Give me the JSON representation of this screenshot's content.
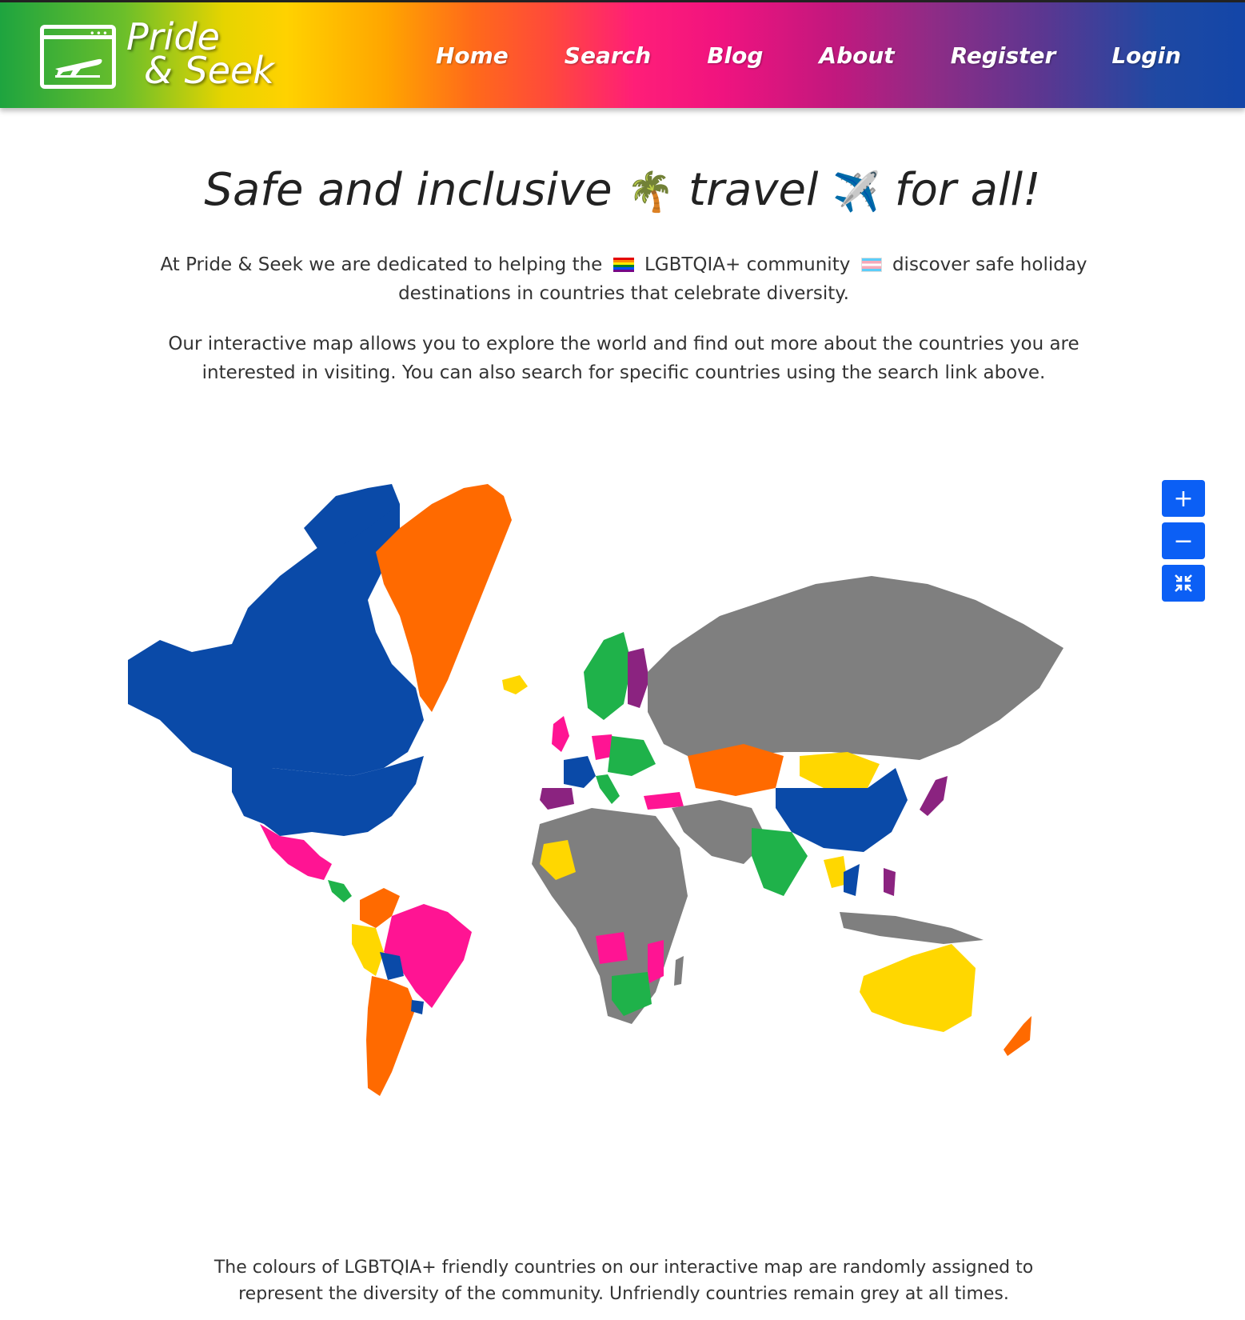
{
  "brand": {
    "line1": "Pride",
    "line2": "& Seek"
  },
  "nav": [
    {
      "label": "Home"
    },
    {
      "label": "Search"
    },
    {
      "label": "Blog"
    },
    {
      "label": "About"
    },
    {
      "label": "Register"
    },
    {
      "label": "Login"
    }
  ],
  "hero": {
    "headline_part1": "Safe and inclusive",
    "headline_emoji1": "🌴",
    "headline_part2": "travel",
    "headline_emoji2": "✈️",
    "headline_part3": "for all!",
    "intro_a": "At Pride & Seek we are dedicated to helping the",
    "intro_b": "LGBTQIA+ community",
    "intro_c": "discover safe holiday destinations in countries that celebrate diversity.",
    "map_intro": "Our interactive map allows you to explore the world and find out more about the countries you are interested in visiting. You can also search for specific countries using the search link above."
  },
  "map_controls": {
    "zoom_in": "+",
    "zoom_out": "−",
    "reset": "⤧"
  },
  "colors": {
    "blue": "#0a4aa8",
    "orange": "#ff6a00",
    "pink": "#ff1493",
    "purple": "#8b2380",
    "green": "#1fb24a",
    "yellow": "#ffd700",
    "grey": "#7f7f7f"
  },
  "footer": {
    "note": "The colours of LGBTQIA+ friendly countries on our interactive map are randomly assigned to represent the diversity of the community. Unfriendly countries remain grey at all times."
  }
}
